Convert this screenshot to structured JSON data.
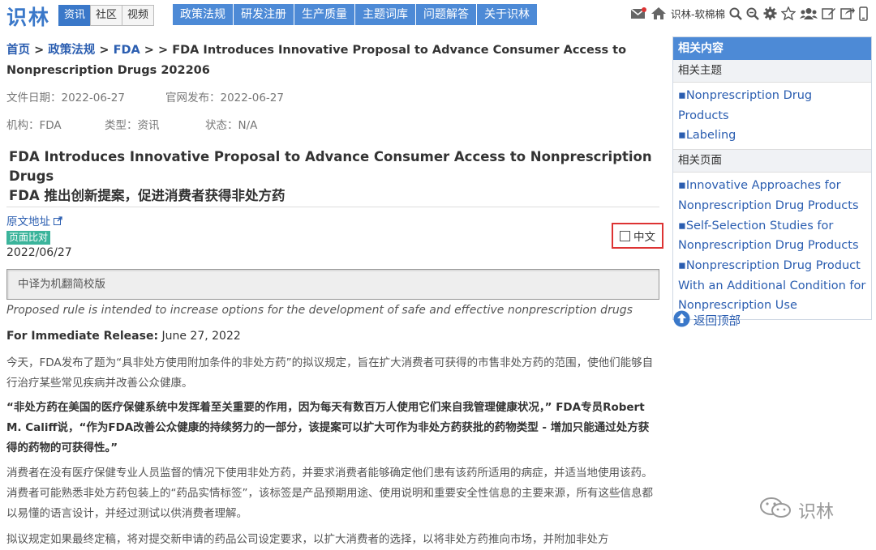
{
  "header": {
    "logo": "识林",
    "scope_tabs": [
      "资讯",
      "社区",
      "视频"
    ],
    "nav": [
      "政策法规",
      "研发注册",
      "生产质量",
      "主题词库",
      "问题解答",
      "关于识林"
    ],
    "user": "识林-软棉棉",
    "icons": [
      "mail-icon",
      "home-icon",
      "search-icon",
      "zoom-icon",
      "gear-icon",
      "star-icon",
      "group-icon",
      "edit-icon",
      "share-icon",
      "mobile-icon"
    ]
  },
  "breadcrumb": {
    "home": "首页",
    "sep1": ">",
    "policy": "政策法规",
    "sep2": ">",
    "fda": "FDA",
    "sep3": "> >",
    "current": "FDA Introduces Innovative Proposal to Advance Consumer Access to Nonprescription Drugs 202206"
  },
  "meta": {
    "doc_date": "文件日期：2022-06-27",
    "publish_date": "官网发布：2022-06-27",
    "agency": "机构：FDA",
    "type": "类型：资讯",
    "status": "状态：N/A"
  },
  "article": {
    "title_en": "FDA Introduces Innovative Proposal to Advance Consumer Access to Nonprescription Drugs",
    "title_zh": "FDA 推出创新提案，促进消费者获得非处方药",
    "orig_link": "原文地址",
    "compare_badge": "页面比对",
    "zh_toggle": "中文",
    "date": "2022/06/27",
    "mt_note": "中译为机翻简校版",
    "subtitle": "Proposed rule is intended to increase options for the development of safe and effective nonprescription drugs",
    "release_label": "For Immediate Release:",
    "release_date": " June 27, 2022",
    "p1": "今天，FDA发布了题为“具非处方使用附加条件的非处方药”的拟议规定，旨在扩大消费者可获得的市售非处方药的范围，使他们能够自行治疗某些常见疾病并改善公众健康。",
    "p2": "“非处方药在美国的医疗保健系统中发挥着至关重要的作用，因为每天有数百万人使用它们来自我管理健康状况，” FDA专员Robert M. Califf说，“作为FDA改善公众健康的持续努力的一部分，该提案可以扩大可作为非处方药获批的药物类型 - 增加只能通过处方获得的药物的可获得性。”",
    "p3": "消费者在没有医疗保健专业人员监督的情况下使用非处方药，并要求消费者能够确定他们患有该药所适用的病症，并适当地使用该药。消费者可能熟悉非处方药包装上的“药品实情标签”，该标签是产品预期用途、使用说明和重要安全性信息的主要来源，所有这些信息都以易懂的语言设计，并经过测试以供消费者理解。",
    "p4": "拟议规定如果最终定稿，将对提交新申请的药品公司设定要求，以扩大消费者的选择，以将非处方药推向市场，并附加非处方"
  },
  "sidebar": {
    "title": "相关内容",
    "topics_label": "相关主题",
    "topics": [
      "Nonprescription Drug Products",
      "Labeling"
    ],
    "pages_label": "相关页面",
    "pages": [
      "Innovative Approaches for Nonprescription Drug Products",
      "Self-Selection Studies for Nonprescription Drug Products",
      "Nonprescription Drug Product With an Additional Condition for Nonprescription Use"
    ],
    "back_top": "返回顶部"
  },
  "watermark": "识林",
  "colors": {
    "brand": "#3a78c9",
    "nav": "#4d8ad6",
    "badge": "#3bb49b",
    "highlight_border": "#dd3333",
    "link": "#2a5db0"
  }
}
